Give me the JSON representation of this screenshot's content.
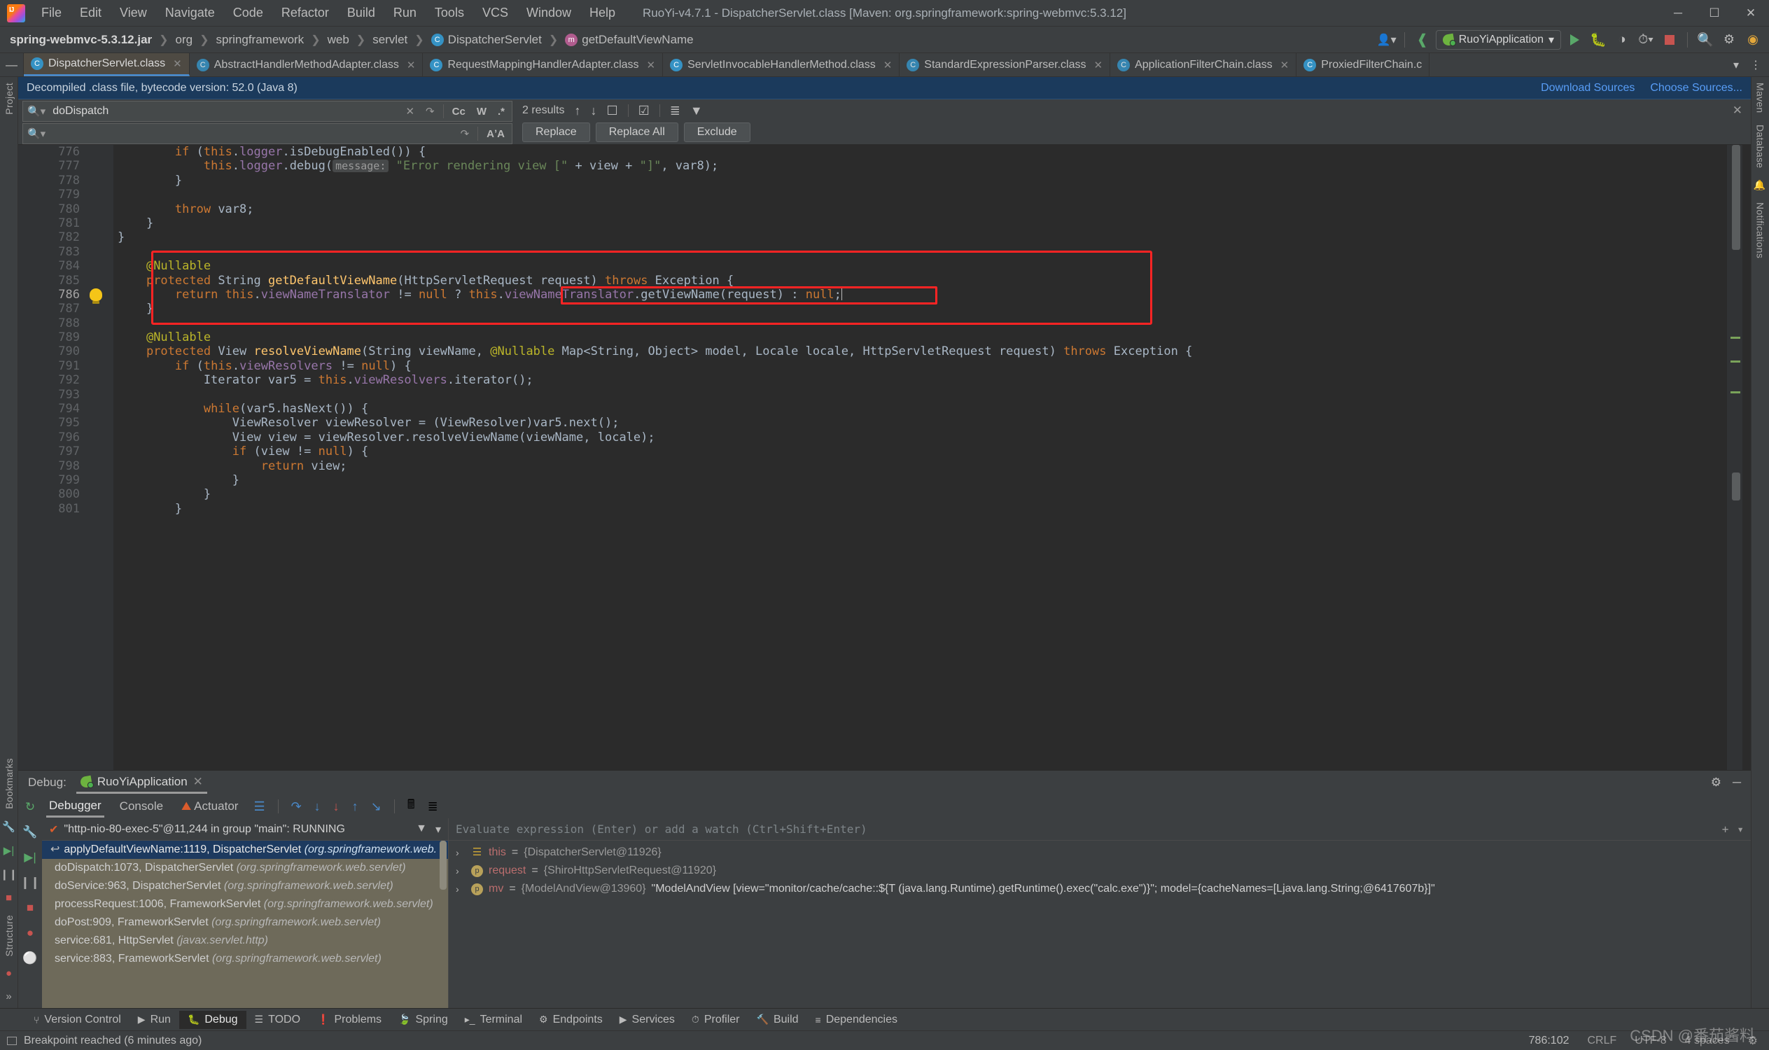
{
  "window": {
    "title": "RuoYi-v4.7.1 - DispatcherServlet.class [Maven: org.springframework:spring-webmvc:5.3.12]",
    "minimize": "─",
    "maximize": "☐",
    "close": "✕"
  },
  "menu": [
    "File",
    "Edit",
    "View",
    "Navigate",
    "Code",
    "Refactor",
    "Build",
    "Run",
    "Tools",
    "VCS",
    "Window",
    "Help"
  ],
  "breadcrumb": {
    "items": [
      {
        "label": "spring-webmvc-5.3.12.jar",
        "icon": "",
        "bold": true
      },
      {
        "label": "org",
        "icon": "",
        "bold": false
      },
      {
        "label": "springframework",
        "icon": "",
        "bold": false
      },
      {
        "label": "web",
        "icon": "",
        "bold": false
      },
      {
        "label": "servlet",
        "icon": "",
        "bold": false
      },
      {
        "label": "DispatcherServlet",
        "icon": "class-icon",
        "bold": false
      },
      {
        "label": "getDefaultViewName",
        "icon": "method-icon",
        "bold": false
      }
    ],
    "run_configuration": "RuoYiApplication",
    "controls": [
      "person-icon",
      "build-hammer-icon",
      "run-icon",
      "debug-icon",
      "coverage-icon",
      "profiler-icon",
      "stop-icon",
      "search-icon",
      "settings-icon",
      "updates-icon"
    ]
  },
  "editor_tabs": [
    {
      "label": "DispatcherServlet.class",
      "active": true
    },
    {
      "label": "AbstractHandlerMethodAdapter.class",
      "active": false
    },
    {
      "label": "RequestMappingHandlerAdapter.class",
      "active": false
    },
    {
      "label": "ServletInvocableHandlerMethod.class",
      "active": false
    },
    {
      "label": "StandardExpressionParser.class",
      "active": false
    },
    {
      "label": "ApplicationFilterChain.class",
      "active": false
    },
    {
      "label": "ProxiedFilterChain.c",
      "active": false
    }
  ],
  "notification": {
    "text": "Decompiled .class file, bytecode version: 52.0 (Java 8)",
    "download_sources": "Download Sources",
    "choose_sources": "Choose Sources..."
  },
  "find": {
    "query": "doDispatch",
    "replace_value": "",
    "results": "2 results",
    "case_label": "Cc",
    "words_label": "W",
    "regex_label": ".*",
    "buttons": [
      "Replace",
      "Replace All",
      "Exclude"
    ],
    "toolbar_icons": [
      "prev-match-icon",
      "next-match-icon",
      "select-all-icon",
      "in-selection-icon",
      "preserve-case-icon",
      "filter-icon"
    ],
    "close_icon": "✕"
  },
  "code": {
    "first_line": 776,
    "lines": [
      {
        "n": 776,
        "html": "        <span class='kw'>if</span> (<span class='kw'>this</span>.<span class='fld'>logger</span>.isDebugEnabled()) {"
      },
      {
        "n": 777,
        "html": "            <span class='kw'>this</span>.<span class='fld'>logger</span>.debug(<span class='param-hint'>message:</span> <span class='str'>\"Error rendering view [\"</span> + view + <span class='str'>\"]\"</span>, var8);"
      },
      {
        "n": 778,
        "html": "        }"
      },
      {
        "n": 779,
        "html": ""
      },
      {
        "n": 780,
        "html": "        <span class='kw'>throw</span> var8;"
      },
      {
        "n": 781,
        "html": "    }"
      },
      {
        "n": 782,
        "html": "}"
      },
      {
        "n": 783,
        "html": ""
      },
      {
        "n": 784,
        "html": "    <span class='ann'>@Nullable</span>"
      },
      {
        "n": 785,
        "html": "    <span class='kw'>protected</span> String <span class='mth'>getDefaultViewName</span>(HttpServletRequest request) <span class='kw'>throws</span> Exception {"
      },
      {
        "n": 786,
        "html": "        <span class='kw'>return</span> <span class='kw'>this</span>.<span class='fld'>viewNameTranslator</span> != <span class='kw'>null</span> ? <span class='kw'>this</span>.<span class='fld'>viewNameTranslator</span>.getViewName(request) : <span class='kw'>null</span>;"
      },
      {
        "n": 787,
        "html": "    }"
      },
      {
        "n": 788,
        "html": ""
      },
      {
        "n": 789,
        "html": "    <span class='ann'>@Nullable</span>"
      },
      {
        "n": 790,
        "html": "    <span class='kw'>protected</span> View <span class='mth'>resolveViewName</span>(String viewName, <span class='ann'>@Nullable</span> Map&lt;String, Object&gt; model, Locale locale, HttpServletRequest request) <span class='kw'>throws</span> Exception {"
      },
      {
        "n": 791,
        "html": "        <span class='kw'>if</span> (<span class='kw'>this</span>.<span class='fld'>viewResolvers</span> != <span class='kw'>null</span>) {"
      },
      {
        "n": 792,
        "html": "            Iterator var5 = <span class='kw'>this</span>.<span class='fld'>viewResolvers</span>.iterator();"
      },
      {
        "n": 793,
        "html": ""
      },
      {
        "n": 794,
        "html": "            <span class='kw'>while</span>(var5.hasNext()) {"
      },
      {
        "n": 795,
        "html": "                ViewResolver viewResolver = (ViewResolver)var5.next();"
      },
      {
        "n": 796,
        "html": "                View view = viewResolver.resolveViewName(viewName, locale);"
      },
      {
        "n": 797,
        "html": "                <span class='kw'>if</span> (view != <span class='kw'>null</span>) {"
      },
      {
        "n": 798,
        "html": "                    <span class='kw'>return</span> view;"
      },
      {
        "n": 799,
        "html": "                }"
      },
      {
        "n": 800,
        "html": "            }"
      },
      {
        "n": 801,
        "html": "        }"
      }
    ],
    "highlight_note": "red-annotation-box",
    "bulb_line": 786
  },
  "debug": {
    "title": "Debug:",
    "session": "RuoYiApplication",
    "close_icon": "✕",
    "settings_icon": "gear-icon",
    "minimize_icon": "─",
    "subtabs": [
      {
        "label": "Debugger",
        "active": true
      },
      {
        "label": "Console",
        "active": false
      },
      {
        "label": "Actuator",
        "active": false
      }
    ],
    "thread": "\"http-nio-80-exec-5\"@11,244 in group \"main\": RUNNING",
    "frames": [
      {
        "text": "applyDefaultViewName:1119, DispatcherServlet ",
        "pkg": "(org.springframework.web.",
        "selected": true
      },
      {
        "text": "doDispatch:1073, DispatcherServlet ",
        "pkg": "(org.springframework.web.servlet)",
        "selected": false
      },
      {
        "text": "doService:963, DispatcherServlet ",
        "pkg": "(org.springframework.web.servlet)",
        "selected": false
      },
      {
        "text": "processRequest:1006, FrameworkServlet ",
        "pkg": "(org.springframework.web.servlet)",
        "selected": false
      },
      {
        "text": "doPost:909, FrameworkServlet ",
        "pkg": "(org.springframework.web.servlet)",
        "selected": false
      },
      {
        "text": "service:681, HttpServlet ",
        "pkg": "(javax.servlet.http)",
        "selected": false
      },
      {
        "text": "service:883, FrameworkServlet ",
        "pkg": "(org.springframework.web.servlet)",
        "selected": false
      }
    ],
    "eval_placeholder": "Evaluate expression (Enter) or add a watch (Ctrl+Shift+Enter)",
    "variables": [
      {
        "icon": "field-icon",
        "name": "this",
        "eq": " = ",
        "value": "{DispatcherServlet@11926}",
        "extra": ""
      },
      {
        "icon": "param-icon",
        "name": "request",
        "eq": " = ",
        "value": "{ShiroHttpServletRequest@11920}",
        "extra": ""
      },
      {
        "icon": "param-icon",
        "name": "mv",
        "eq": " = ",
        "value": "{ModelAndView@13960}",
        "extra": "\"ModelAndView [view=\"monitor/cache/cache::${T  (java.lang.Runtime).getRuntime().exec(\"calc.exe\")}\"; model={cacheNames=[Ljava.lang.String;@6417607b}]\""
      }
    ]
  },
  "tool_windows": [
    {
      "label": "Version Control",
      "icon": "vcs-icon",
      "active": false
    },
    {
      "label": "Run",
      "icon": "run-icon",
      "active": false
    },
    {
      "label": "Debug",
      "icon": "debug-icon",
      "active": true
    },
    {
      "label": "TODO",
      "icon": "todo-icon",
      "active": false
    },
    {
      "label": "Problems",
      "icon": "problems-icon",
      "active": false
    },
    {
      "label": "Spring",
      "icon": "spring-icon",
      "active": false
    },
    {
      "label": "Terminal",
      "icon": "terminal-icon",
      "active": false
    },
    {
      "label": "Endpoints",
      "icon": "endpoints-icon",
      "active": false
    },
    {
      "label": "Services",
      "icon": "services-icon",
      "active": false
    },
    {
      "label": "Profiler",
      "icon": "profiler-icon",
      "active": false
    },
    {
      "label": "Build",
      "icon": "build-icon",
      "active": false
    },
    {
      "label": "Dependencies",
      "icon": "dependencies-icon",
      "active": false
    }
  ],
  "status": {
    "message": "Breakpoint reached (6 minutes ago)",
    "caret": "786:102",
    "line_separator": "CRLF",
    "encoding": "UTF-8",
    "indent": "4 spaces",
    "watermark": "CSDN @番茄酱料"
  },
  "rails": {
    "left": [
      "Project",
      "Bookmarks",
      "Structure"
    ],
    "right": [
      "Maven",
      "Database",
      "Notifications"
    ]
  }
}
